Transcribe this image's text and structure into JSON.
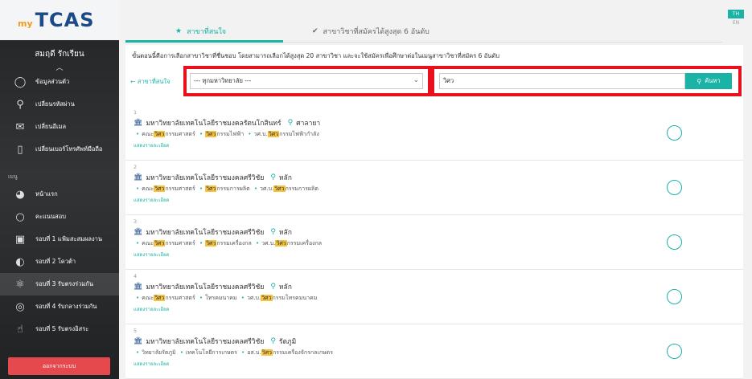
{
  "logo": {
    "prefix": "my",
    "name": "TCAS"
  },
  "lang": {
    "th": "TH",
    "en": "EN"
  },
  "user": {
    "name": "สมฤดี รักเรียน"
  },
  "account_menu": [
    {
      "label": "ข้อมูลส่วนตัว",
      "icon": "user-icon"
    },
    {
      "label": "เปลี่ยนรหัสผ่าน",
      "icon": "key-icon"
    },
    {
      "label": "เปลี่ยนอีเมล",
      "icon": "mail-icon"
    },
    {
      "label": "เปลี่ยนเบอร์โทรศัพท์มือถือ",
      "icon": "phone-icon"
    }
  ],
  "main_menu_section": "เมนู",
  "main_menu": [
    {
      "label": "หน้าแรก",
      "icon": "dashboard-icon",
      "active": false
    },
    {
      "label": "คะแนนสอบ",
      "icon": "circle-icon",
      "active": false
    },
    {
      "label": "รอบที่ 1 แฟ้มสะสมผลงาน",
      "icon": "portfolio-icon",
      "active": false
    },
    {
      "label": "รอบที่ 2 โควต้า",
      "icon": "quota-icon",
      "active": false
    },
    {
      "label": "รอบที่ 3 รับตรงร่วมกัน",
      "icon": "atom-icon",
      "active": true
    },
    {
      "label": "รอบที่ 4 รับกลางร่วมกัน",
      "icon": "rings-icon",
      "active": false
    },
    {
      "label": "รอบที่ 5 รับตรงอิสระ",
      "icon": "hand-icon",
      "active": false
    }
  ],
  "logout_label": "ออกจากระบบ",
  "tabs": [
    {
      "label": "สาขาที่สนใจ",
      "active": true
    },
    {
      "label": "สาขาวิชาที่สมัครได้สูงสุด 6 อันดับ",
      "active": false
    }
  ],
  "instruction": "ขั้นตอนนี้คือการเลือกสาขาวิชาที่ชื่นชอบ โดยสามารถเลือกได้สูงสุด 20 สาขาวิชา และจะใช้สมัครเพื่อศึกษาต่อในเมนูสาขาวิชาที่สมัคร 6 อันดับ",
  "filter": {
    "back_label": "สาขาที่สนใจ",
    "university_value": "--- ทุกมหาวิทยาลัย ---",
    "search_value": "วิศว",
    "search_button": "ค้นหา"
  },
  "results": [
    {
      "num": "1",
      "university": "มหาวิทยาลัยเทคโนโลยีราชมงคลรัตนโกสินทร์",
      "campus": "ศาลายา",
      "path": [
        {
          "pre": "คณะ",
          "hl": "วิศว",
          "post": "กรรมศาสตร์"
        },
        {
          "pre": "",
          "hl": "วิศว",
          "post": "กรรมไฟฟ้า"
        },
        {
          "pre": "วศ.บ.",
          "hl": "วิศว",
          "post": "กรรมไฟฟ้ากำลัง"
        }
      ],
      "detail": "แสดงรายละเอียด"
    },
    {
      "num": "2",
      "university": "มหาวิทยาลัยเทคโนโลยีราชมงคลศรีวิชัย",
      "campus": "หลัก",
      "path": [
        {
          "pre": "คณะ",
          "hl": "วิศว",
          "post": "กรรมศาสตร์"
        },
        {
          "pre": "",
          "hl": "วิศว",
          "post": "กรรมการผลิต"
        },
        {
          "pre": "วศ.บ.",
          "hl": "วิศว",
          "post": "กรรมการผลิต"
        }
      ],
      "detail": "แสดงรายละเอียด"
    },
    {
      "num": "3",
      "university": "มหาวิทยาลัยเทคโนโลยีราชมงคลศรีวิชัย",
      "campus": "หลัก",
      "path": [
        {
          "pre": "คณะ",
          "hl": "วิศว",
          "post": "กรรมศาสตร์"
        },
        {
          "pre": "",
          "hl": "วิศว",
          "post": "กรรมเครื่องกล"
        },
        {
          "pre": "วศ.บ.",
          "hl": "วิศว",
          "post": "กรรมเครื่องกล"
        }
      ],
      "detail": "แสดงรายละเอียด"
    },
    {
      "num": "4",
      "university": "มหาวิทยาลัยเทคโนโลยีราชมงคลศรีวิชัย",
      "campus": "หลัก",
      "path": [
        {
          "pre": "คณะ",
          "hl": "วิศว",
          "post": "กรรมศาสตร์"
        },
        {
          "pre": "โทรคมนาคม",
          "hl": "",
          "post": ""
        },
        {
          "pre": "วศ.บ.",
          "hl": "วิศว",
          "post": "กรรมโทรคมนาคม"
        }
      ],
      "detail": "แสดงรายละเอียด"
    },
    {
      "num": "5",
      "university": "มหาวิทยาลัยเทคโนโลยีราชมงคลศรีวิชัย",
      "campus": "รัตภูมิ",
      "path": [
        {
          "pre": "วิทยาลัยรัตภูมิ",
          "hl": "",
          "post": ""
        },
        {
          "pre": "เทคโนโลยีการเกษตร",
          "hl": "",
          "post": ""
        },
        {
          "pre": "อส.บ.",
          "hl": "วิศว",
          "post": "กรรมเครื่องจักรกลเกษตร"
        }
      ],
      "detail": "แสดงรายละเอียด"
    }
  ],
  "colors": {
    "accent": "#1ab3a6",
    "highlight": "#f5c342",
    "annotation": "#e8101c",
    "logout": "#e5484d"
  }
}
